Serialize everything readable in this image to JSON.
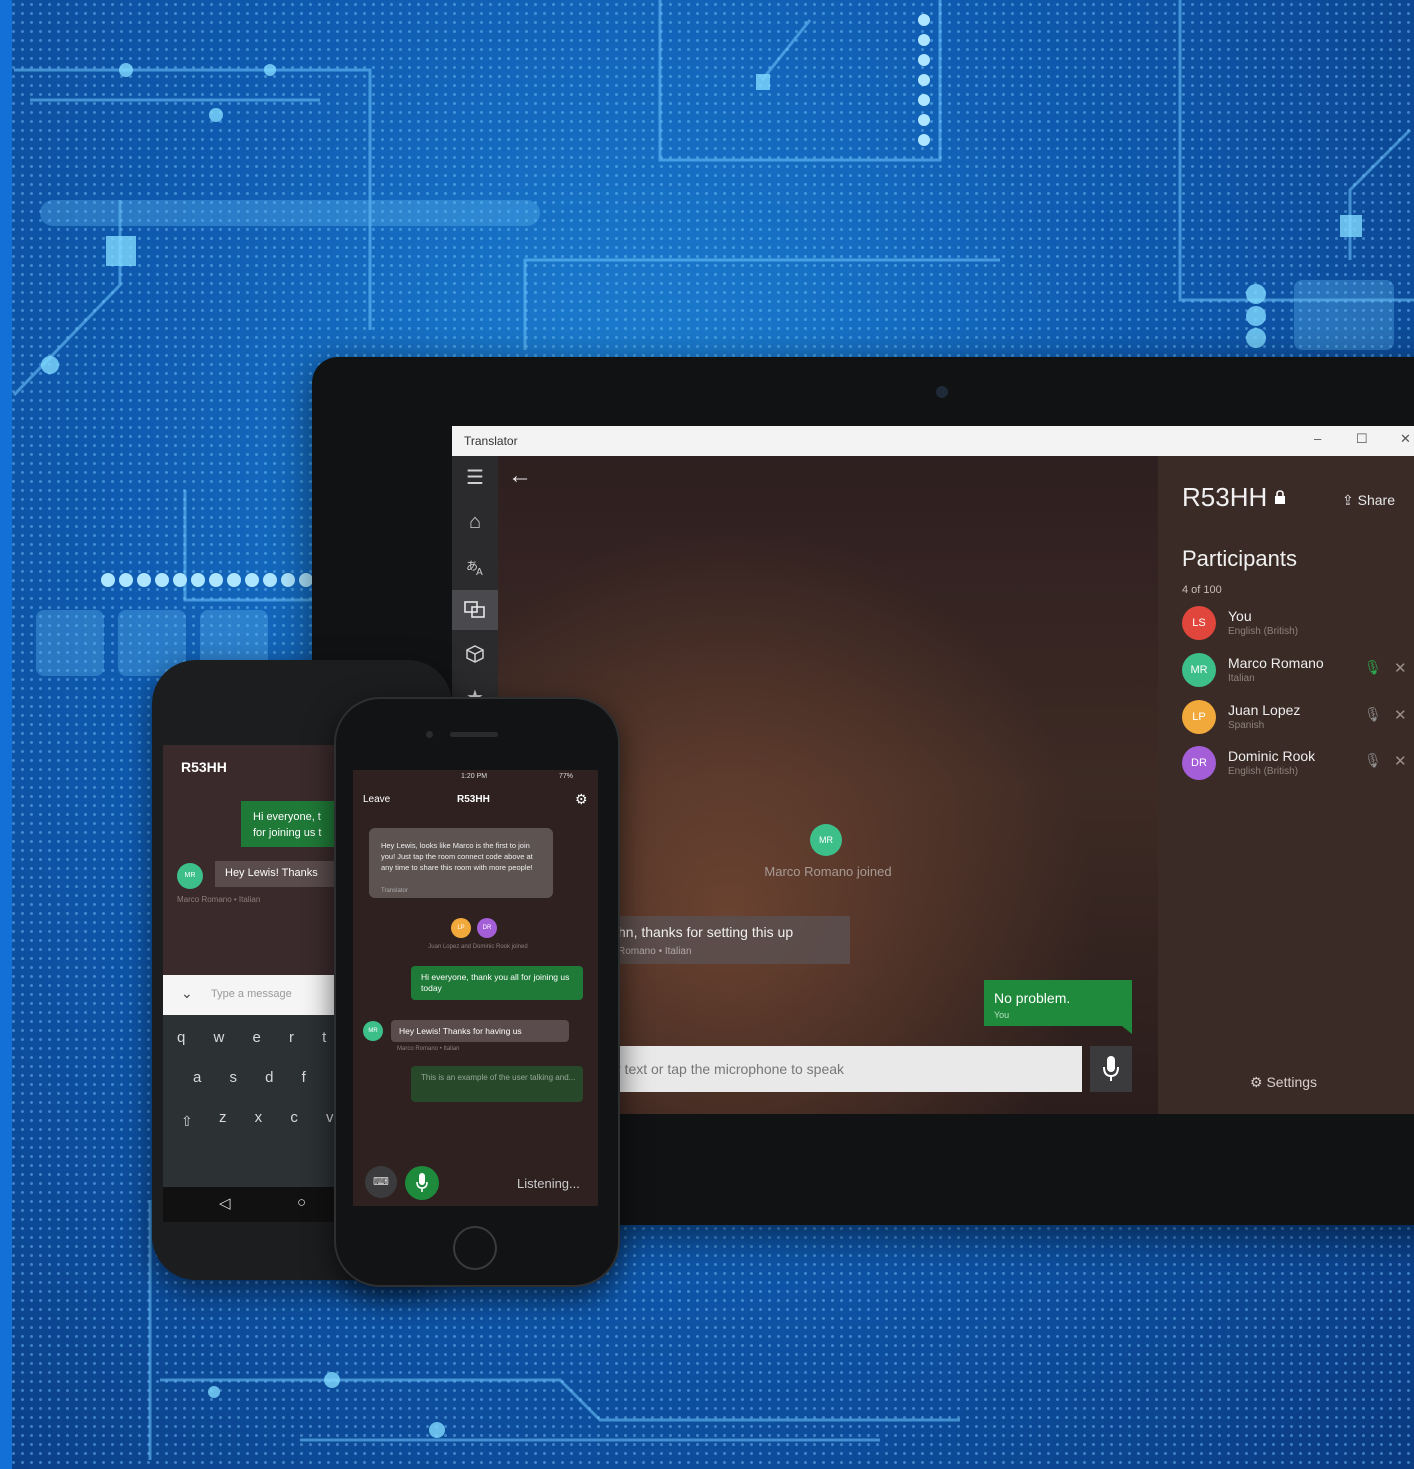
{
  "window": {
    "title": "Translator",
    "controls": {
      "minimize": "–",
      "maximize": "☐",
      "close": "✕"
    }
  },
  "nav": {
    "icons": [
      "hamburger-icon",
      "home-icon",
      "translate-text-icon",
      "conversation-icon",
      "package-icon",
      "star-icon"
    ]
  },
  "chat": {
    "joined_avatar": "MR",
    "joined_text": "Marco Romano joined",
    "left_message": "hn, thanks for setting this up",
    "left_sender": "Romano • Italian",
    "right_message": "No problem.",
    "right_sender": "You",
    "input_placeholder": "r text or tap the microphone to speak"
  },
  "sidebar": {
    "room_code": "R53HH",
    "share_label": "Share",
    "participants_title": "Participants",
    "participants_count": "4 of 100",
    "participants": [
      {
        "initials": "LS",
        "name": "You",
        "language": "English (British)",
        "color": "#e0463c"
      },
      {
        "initials": "MR",
        "name": "Marco Romano",
        "language": "Italian",
        "color": "#3dbf8a"
      },
      {
        "initials": "LP",
        "name": "Juan Lopez",
        "language": "Spanish",
        "color": "#f2a93b"
      },
      {
        "initials": "DR",
        "name": "Dominic Rook",
        "language": "English (British)",
        "color": "#a45fd8"
      }
    ],
    "settings_label": "Settings"
  },
  "android": {
    "room_code": "R53HH",
    "outgoing": "Hi everyone, t\nfor joining us t",
    "avatar": "MR",
    "incoming": "Hey Lewis! Thanks",
    "incoming_meta": "Marco Romano • Italian",
    "input_placeholder": "Type a message",
    "keyboard_rows": [
      "q w e r t y",
      "a s d f g h",
      "z x c v b"
    ],
    "nav": {
      "back": "◁",
      "home": "○"
    }
  },
  "iphone": {
    "status_time": "1:20 PM",
    "status_battery": "77%",
    "leave_label": "Leave",
    "room_code": "R53HH",
    "bot_message": "Hey Lewis, looks like Marco is the first to join you! Just tap the room connect code above at any time to share this room with more people!",
    "bot_meta": "Translator",
    "join_avatars": [
      "LP",
      "DR"
    ],
    "join_text": "Juan Lopez and Dominic Rook joined",
    "outgoing": "Hi everyone, thank you all for joining us today",
    "incoming": "Hey Lewis! Thanks for having us",
    "incoming_meta": "Marco Romano • Italian",
    "draft": "This is an example of the user talking and...",
    "listening_label": "Listening..."
  }
}
